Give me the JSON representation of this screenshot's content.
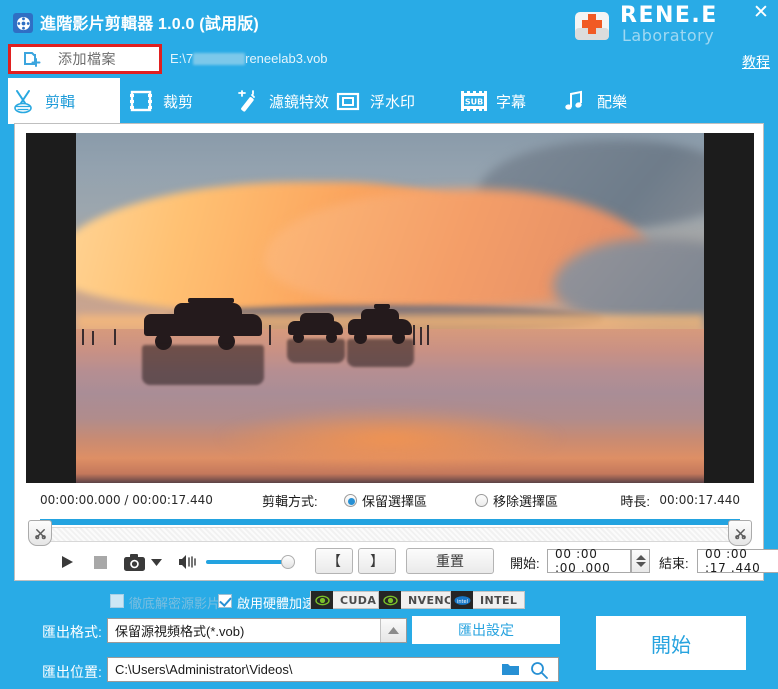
{
  "window": {
    "title": "進階影片剪輯器 1.0.0 (試用版)",
    "app_icon": "film-reel-icon",
    "close_label": "✕",
    "accent_color": "#29ABE6"
  },
  "brand": {
    "name": "RENE.E",
    "sub": "Laboratory",
    "tutorial_link": "教程"
  },
  "toolbar": {
    "add_file_label": "添加檔案",
    "add_file_icon": "add-folder-icon",
    "file_path_prefix": "E:\\7",
    "file_path_suffix": "reneelab3.vob",
    "highlight_color": "#E02020"
  },
  "tabs": [
    {
      "label": "剪輯",
      "icon": "scissors-icon",
      "active": true
    },
    {
      "label": "裁剪",
      "icon": "film-crop-icon",
      "active": false
    },
    {
      "label": "濾鏡特效",
      "icon": "magic-wand-icon",
      "active": false
    },
    {
      "label": "浮水印",
      "icon": "watermark-icon",
      "active": false
    },
    {
      "label": "字幕",
      "icon": "subtitle-icon",
      "active": false
    },
    {
      "label": "配樂",
      "icon": "music-note-icon",
      "active": false
    }
  ],
  "player": {
    "current_time": "00:00:00.000",
    "total_time": "00:00:17.440",
    "time_display": "00:00:00.000 / 00:00:17.440",
    "duration_label": "時長:",
    "duration_value": "00:00:17.440",
    "trim_mode_label": "剪輯方式:",
    "trim_modes": [
      {
        "label": "保留選擇區",
        "selected": true
      },
      {
        "label": "移除選擇區",
        "selected": false
      }
    ],
    "progress_percent": 100,
    "volume_percent": 92
  },
  "controls": {
    "play_icon": "play-icon",
    "stop_icon": "stop-icon",
    "snapshot_icon": "camera-icon",
    "snapshot_dropdown_icon": "chevron-down-icon",
    "volume_icon": "volume-icon",
    "mark_in_label": "【",
    "mark_out_label": "】",
    "reset_label": "重置",
    "start_label": "開始:",
    "start_value": "00 :00 :00 .000",
    "end_label": "結束:",
    "end_value": "00 :00 :17 .440"
  },
  "hardware": {
    "decrypt_label": "徹底解密源影片",
    "decrypt_checked": false,
    "decrypt_disabled": true,
    "accel_label": "啟用硬體加速",
    "accel_checked": true,
    "badges": [
      {
        "label": "CUDA",
        "icon": "nvidia-icon"
      },
      {
        "label": "NVENC",
        "icon": "nvidia-icon"
      },
      {
        "label": "INTEL",
        "icon": "intel-icon"
      }
    ]
  },
  "export": {
    "format_label": "匯出格式:",
    "format_value": "保留源視頻格式(*.vob)",
    "format_arrow_icon": "chevron-up-icon",
    "location_label": "匯出位置:",
    "location_value": "C:\\Users\\Administrator\\Videos\\",
    "folder_icon": "folder-icon",
    "search_icon": "search-icon",
    "settings_label": "匯出設定",
    "start_button_label": "開始"
  }
}
